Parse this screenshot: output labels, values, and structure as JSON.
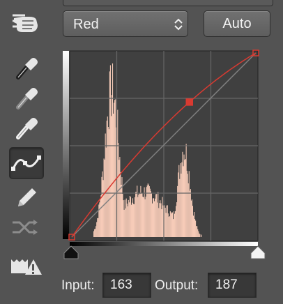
{
  "channel": {
    "selected": "Red"
  },
  "auto_button": {
    "label": "Auto"
  },
  "tools": [
    {
      "name": "on-image-adjustment-hand-icon"
    },
    {
      "name": "black-point-eyedropper-icon"
    },
    {
      "name": "gray-point-eyedropper-icon"
    },
    {
      "name": "white-point-eyedropper-icon"
    },
    {
      "name": "curve-point-tool-icon",
      "selected": true
    },
    {
      "name": "pencil-draw-icon"
    },
    {
      "name": "smooth-curve-icon",
      "disabled": true
    },
    {
      "name": "clipping-warning-icon"
    }
  ],
  "curve": {
    "points": [
      [
        0,
        0
      ],
      [
        163,
        187
      ],
      [
        255,
        255
      ]
    ],
    "color": "#d93a31",
    "histogram_color": "#f6cbb8"
  },
  "fields": {
    "input_label": "Input:",
    "input_value": "163",
    "output_label": "Output:",
    "output_value": "187"
  }
}
